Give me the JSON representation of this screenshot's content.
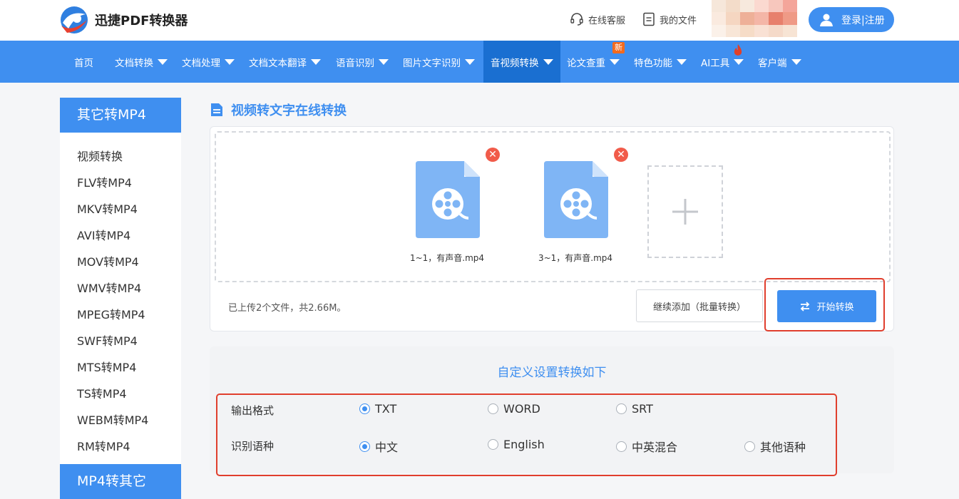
{
  "header": {
    "brand": "迅捷PDF转换器",
    "service_label": "在线客服",
    "files_label": "我的文件",
    "login_label": "登录|注册"
  },
  "nav": {
    "items": [
      {
        "label": "首页",
        "caret": false
      },
      {
        "label": "文档转换",
        "caret": true
      },
      {
        "label": "文档处理",
        "caret": true
      },
      {
        "label": "文档文本翻译",
        "caret": true
      },
      {
        "label": "语音识别",
        "caret": true
      },
      {
        "label": "图片文字识别",
        "caret": true
      },
      {
        "label": "音视频转换",
        "caret": true,
        "active": true
      },
      {
        "label": "论文查重",
        "caret": true,
        "badge": "新"
      },
      {
        "label": "特色功能",
        "caret": true
      },
      {
        "label": "AI工具",
        "caret": true,
        "fire": true
      },
      {
        "label": "客户端",
        "caret": true
      }
    ]
  },
  "sidebar": {
    "heading": "其它转MP4",
    "items": [
      "视频转换",
      "FLV转MP4",
      "MKV转MP4",
      "AVI转MP4",
      "MOV转MP4",
      "WMV转MP4",
      "MPEG转MP4",
      "SWF转MP4",
      "MTS转MP4",
      "TS转MP4",
      "WEBM转MP4",
      "RM转MP4"
    ],
    "heading2": "MP4转其它"
  },
  "main": {
    "title": "视频转文字在线转换",
    "files": [
      {
        "name": "1~1，有声音.mp4"
      },
      {
        "name": "3~1，有声音.mp4"
      }
    ],
    "status": "已上传2个文件，共2.66M。",
    "continue_label": "继续添加（批量转换）",
    "start_label": "开始转换"
  },
  "settings": {
    "title": "自定义设置转换如下",
    "format_label": "输出格式",
    "format_options": [
      {
        "label": "TXT",
        "selected": true
      },
      {
        "label": "WORD",
        "selected": false
      },
      {
        "label": "SRT",
        "selected": false
      }
    ],
    "lang_label": "识别语种",
    "lang_options": [
      {
        "label": "中文",
        "selected": true
      },
      {
        "label": "English",
        "selected": false
      },
      {
        "label": "中英混合",
        "selected": false
      },
      {
        "label": "其他语种",
        "selected": false
      }
    ]
  },
  "colors": {
    "primary": "#3f8ff0",
    "nav_active": "#1a6fd1",
    "highlight": "#e03e2d",
    "delete": "#f15b4a"
  }
}
